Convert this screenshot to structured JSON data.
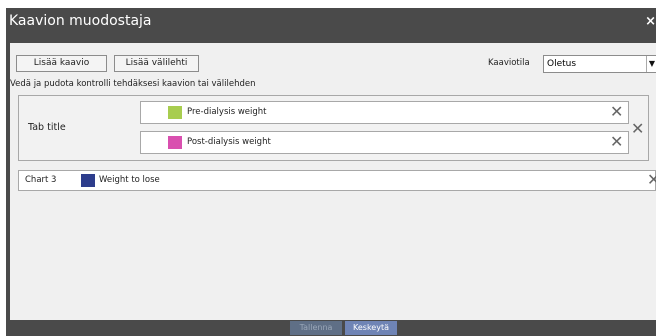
{
  "window": {
    "title": "Kaavion muodostaja",
    "close_glyph": "×"
  },
  "toolbar": {
    "add_chart_label": "Lisää kaavio",
    "add_tab_label": "Lisää välilehti",
    "chart_mode_label": "Kaaviotila",
    "chart_mode_value": "Oletus",
    "dropdown_glyph": "▼"
  },
  "instructions": "Vedä ja pudota kontrolli tehdäksesi kaavion tai välilehden",
  "tab": {
    "title": "Tab title",
    "charts": [
      {
        "label": "Pre-dialysis weight",
        "color": "#a8cd4f"
      },
      {
        "label": "Post-dialysis weight",
        "color": "#d94faf"
      }
    ]
  },
  "chart3": {
    "name": "Chart 3",
    "label": "Weight to lose",
    "color": "#2d3d8c"
  },
  "remove_glyph": "✕",
  "footer": {
    "save_label": "Tallenna",
    "cancel_label": "Keskeytä"
  }
}
